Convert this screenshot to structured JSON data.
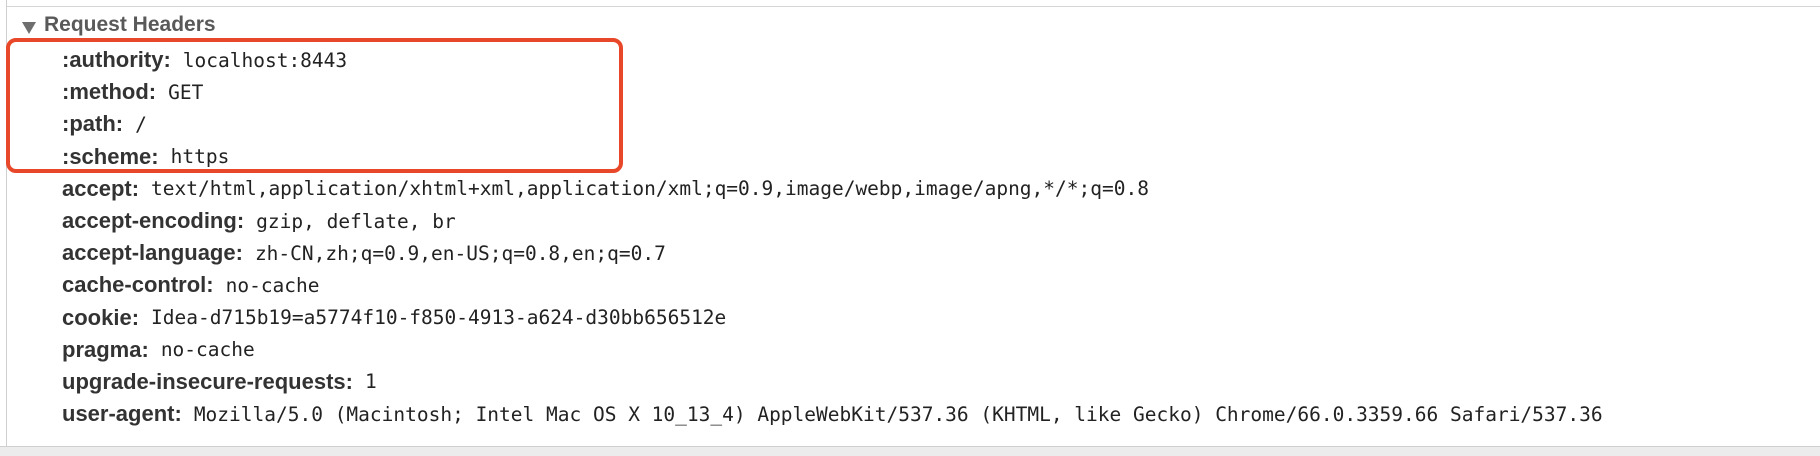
{
  "section": {
    "title": "Request Headers",
    "expanded": true,
    "toggle_icon": "triangle-down-icon"
  },
  "headers": [
    {
      "key": ":authority",
      "value": "localhost:8443"
    },
    {
      "key": ":method",
      "value": "GET"
    },
    {
      "key": ":path",
      "value": "/"
    },
    {
      "key": ":scheme",
      "value": "https"
    },
    {
      "key": "accept",
      "value": "text/html,application/xhtml+xml,application/xml;q=0.9,image/webp,image/apng,*/*;q=0.8"
    },
    {
      "key": "accept-encoding",
      "value": "gzip, deflate, br"
    },
    {
      "key": "accept-language",
      "value": "zh-CN,zh;q=0.9,en-US;q=0.8,en;q=0.7"
    },
    {
      "key": "cache-control",
      "value": "no-cache"
    },
    {
      "key": "cookie",
      "value": "Idea-d715b19=a5774f10-f850-4913-a624-d30bb656512e"
    },
    {
      "key": "pragma",
      "value": "no-cache"
    },
    {
      "key": "upgrade-insecure-requests",
      "value": "1"
    },
    {
      "key": "user-agent",
      "value": "Mozilla/5.0 (Macintosh; Intel Mac OS X 10_13_4) AppleWebKit/537.36 (KHTML, like Gecko) Chrome/66.0.3359.66 Safari/537.36"
    }
  ],
  "annotation": {
    "color": "#e8472a"
  }
}
